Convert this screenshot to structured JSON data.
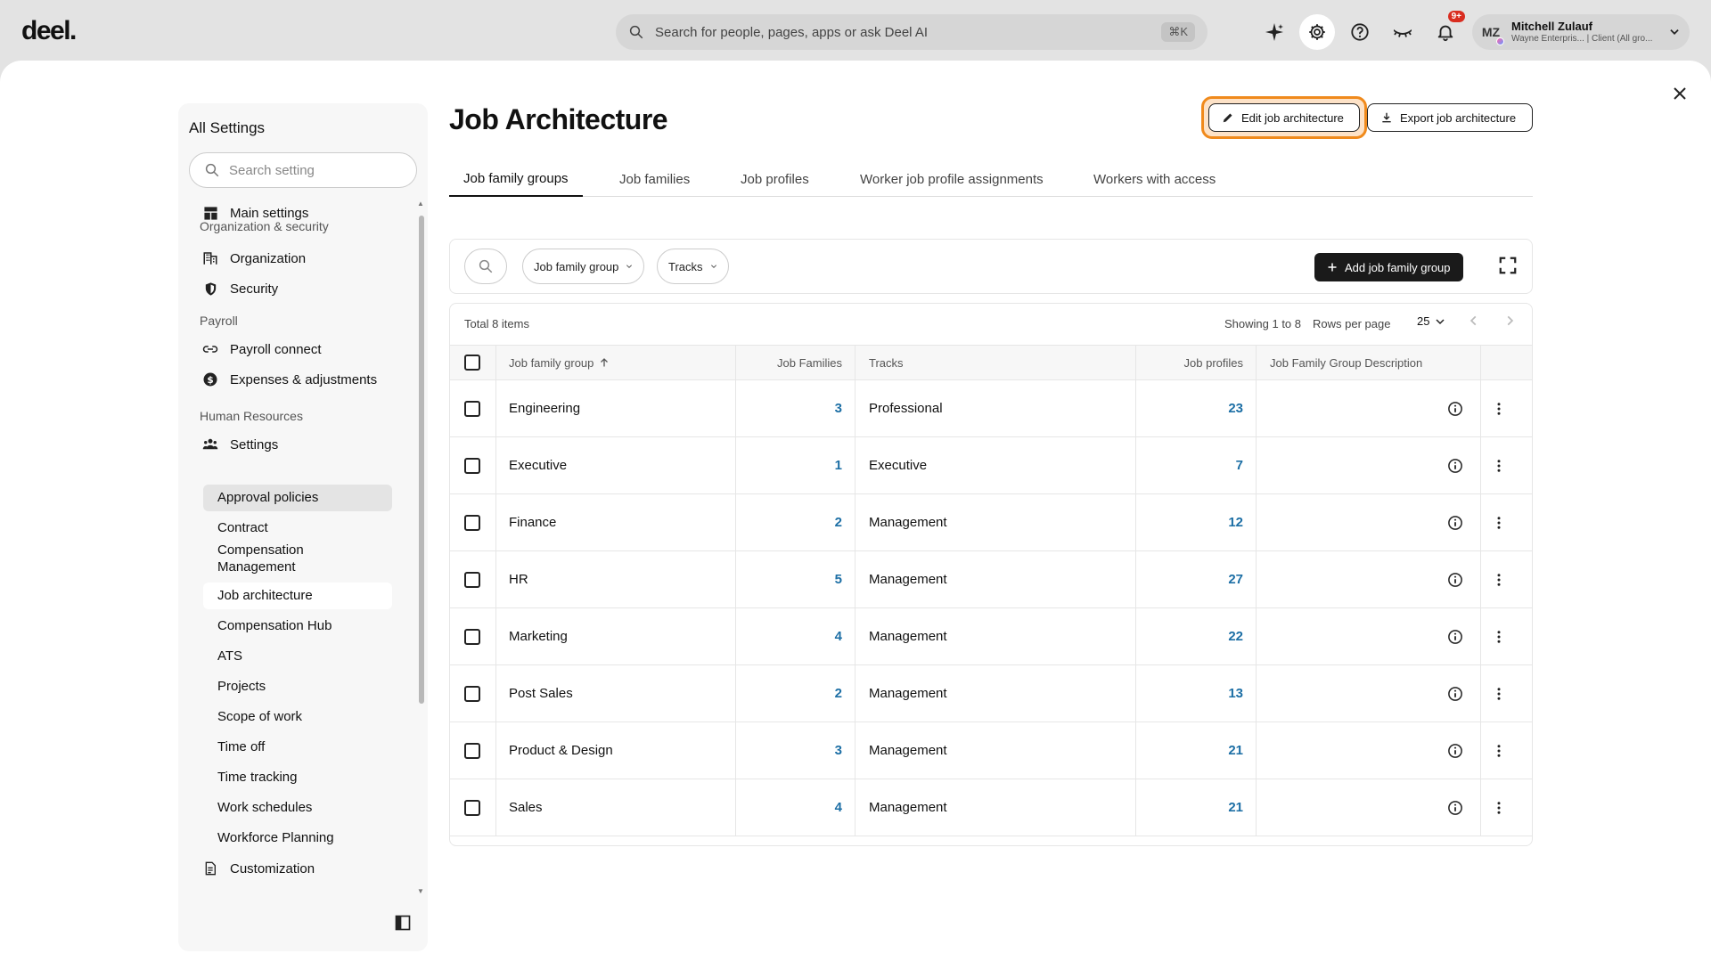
{
  "topbar": {
    "logo": "deel.",
    "search_placeholder": "Search for people, pages, apps or ask Deel AI",
    "shortcut": "⌘K",
    "notification_count": "9+",
    "user": {
      "initials": "MZ",
      "name": "Mitchell Zulauf",
      "subtitle": "Wayne Enterpris... | Client (All gro..."
    }
  },
  "sidebar": {
    "title": "All Settings",
    "search_placeholder": "Search setting",
    "items": {
      "main_settings": "Main settings",
      "org_security_section": "Organization & security",
      "organization": "Organization",
      "security": "Security",
      "payroll_section": "Payroll",
      "payroll_connect": "Payroll connect",
      "expenses": "Expenses & adjustments",
      "hr_section": "Human Resources",
      "settings": "Settings",
      "customization": "Customization"
    },
    "sub_items": [
      "Approval policies",
      "Contract",
      "Compensation Management",
      "Job architecture",
      "Compensation Hub",
      "ATS",
      "Projects",
      "Scope of work",
      "Time off",
      "Time tracking",
      "Work schedules",
      "Workforce Planning"
    ]
  },
  "page": {
    "title": "Job Architecture",
    "edit_button": "Edit job architecture",
    "export_button": "Export job architecture",
    "tabs": [
      "Job family groups",
      "Job families",
      "Job profiles",
      "Worker job profile assignments",
      "Workers with access"
    ],
    "active_tab": "Job family groups"
  },
  "filters": {
    "job_family_group": "Job family group",
    "tracks": "Tracks",
    "add_button": "Add job family group"
  },
  "table": {
    "total": "Total 8 items",
    "showing": "Showing 1 to 8",
    "rows_per_page_label": "Rows per page",
    "rows_per_page": "25",
    "headers": {
      "group": "Job family group",
      "families": "Job Families",
      "tracks": "Tracks",
      "profiles": "Job profiles",
      "description": "Job Family Group Description"
    },
    "rows": [
      {
        "group": "Engineering",
        "families": "3",
        "tracks": "Professional",
        "profiles": "23"
      },
      {
        "group": "Executive",
        "families": "1",
        "tracks": "Executive",
        "profiles": "7"
      },
      {
        "group": "Finance",
        "families": "2",
        "tracks": "Management",
        "profiles": "12"
      },
      {
        "group": "HR",
        "families": "5",
        "tracks": "Management",
        "profiles": "27"
      },
      {
        "group": "Marketing",
        "families": "4",
        "tracks": "Management",
        "profiles": "22"
      },
      {
        "group": "Post Sales",
        "families": "2",
        "tracks": "Management",
        "profiles": "13"
      },
      {
        "group": "Product & Design",
        "families": "3",
        "tracks": "Management",
        "profiles": "21"
      },
      {
        "group": "Sales",
        "families": "4",
        "tracks": "Management",
        "profiles": "21"
      }
    ]
  },
  "colors": {
    "accent_link": "#1d6fa5",
    "highlight": "#f08a1c",
    "badge": "#d92d20"
  }
}
